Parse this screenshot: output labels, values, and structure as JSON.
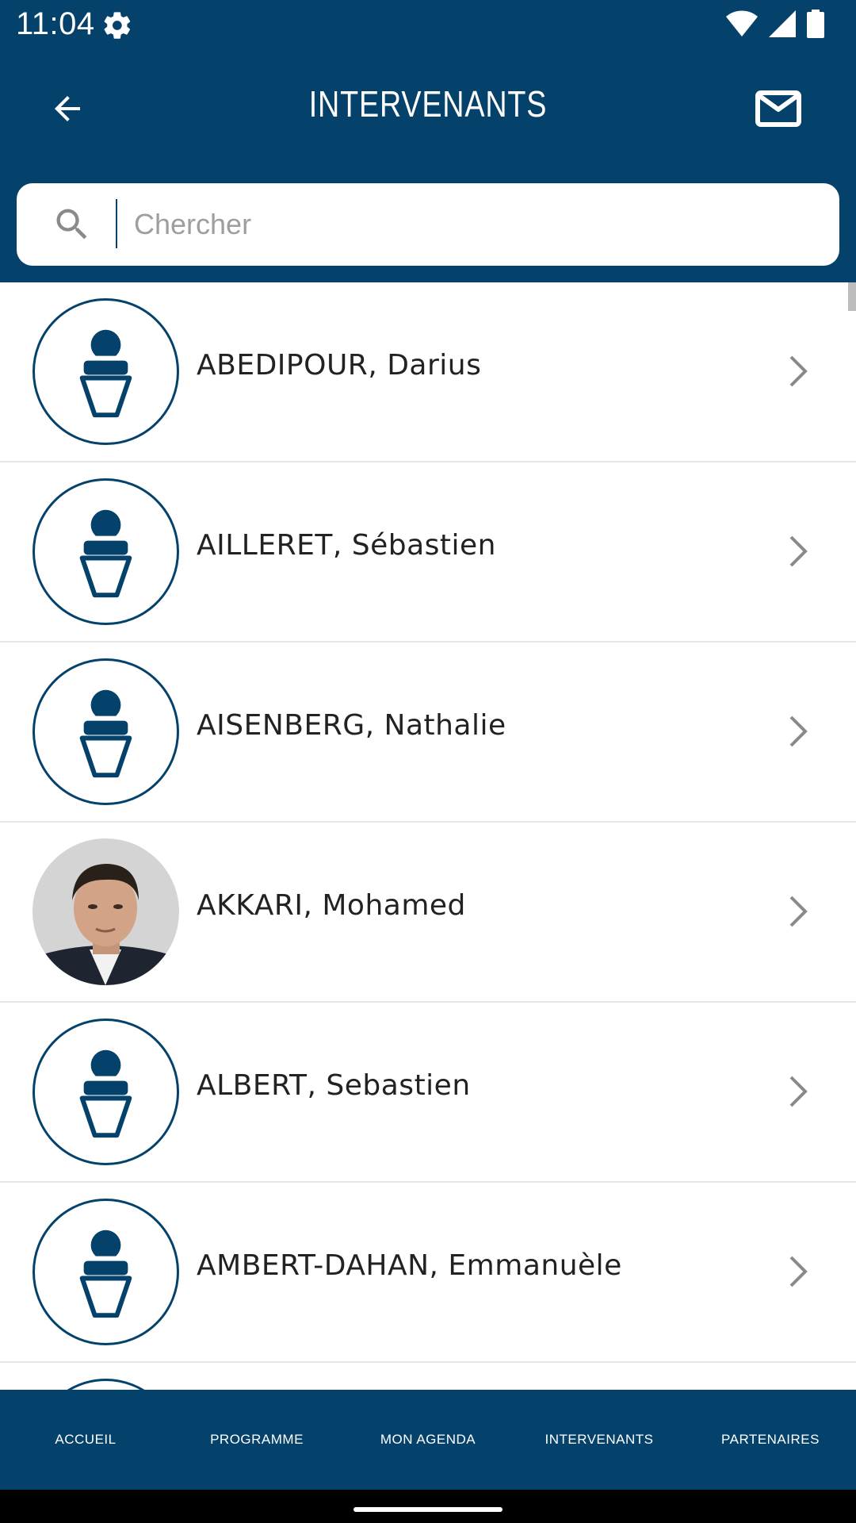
{
  "status_bar": {
    "time": "11:04",
    "icons": [
      "gear-icon",
      "wifi-icon",
      "signal-icon",
      "battery-icon"
    ]
  },
  "header": {
    "title": "INTERVENANTS",
    "back_icon": "arrow-back-icon",
    "mail_icon": "mail-icon"
  },
  "search": {
    "placeholder": "Chercher",
    "value": ""
  },
  "speakers": [
    {
      "name": "ABEDIPOUR, Darius",
      "avatar": "placeholder"
    },
    {
      "name": "AILLERET, Sébastien",
      "avatar": "placeholder"
    },
    {
      "name": "AISENBERG, Nathalie",
      "avatar": "placeholder"
    },
    {
      "name": "AKKARI, Mohamed",
      "avatar": "photo"
    },
    {
      "name": "ALBERT, Sebastien",
      "avatar": "placeholder"
    },
    {
      "name": "AMBERT-DAHAN, Emmanuèle",
      "avatar": "placeholder"
    }
  ],
  "bottom_nav": [
    {
      "label": "ACCUEIL"
    },
    {
      "label": "PROGRAMME"
    },
    {
      "label": "MON AGENDA"
    },
    {
      "label": "INTERVENANTS"
    },
    {
      "label": "PARTENAIRES"
    }
  ],
  "colors": {
    "primary": "#04426b",
    "background": "#ffffff",
    "divider": "#e6e6e6",
    "text": "#222222"
  }
}
